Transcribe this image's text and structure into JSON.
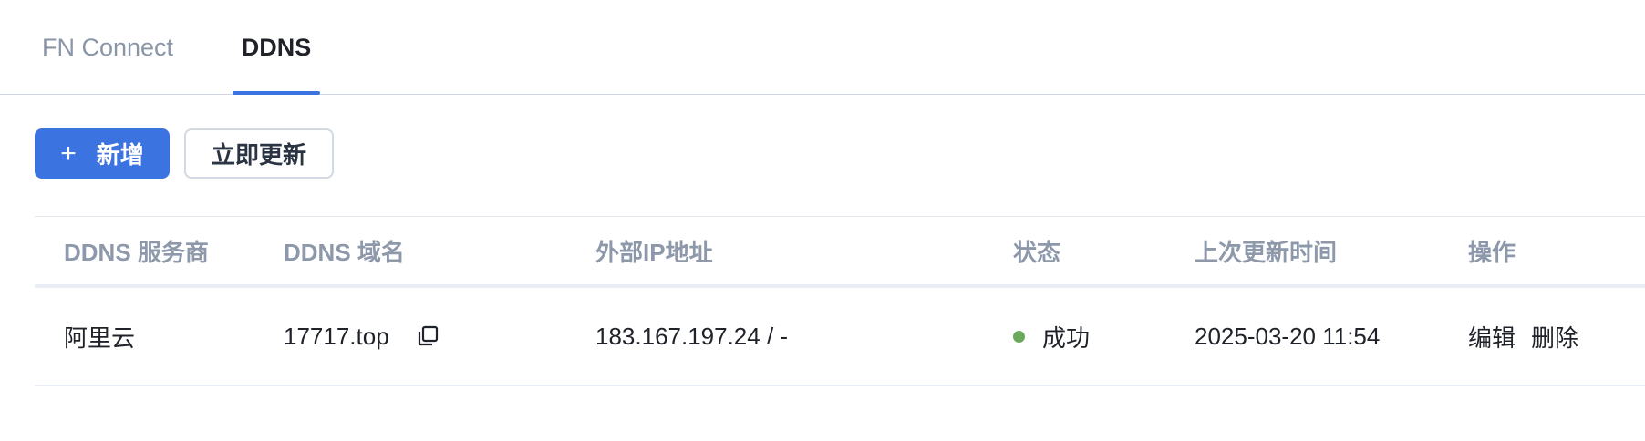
{
  "tabs": [
    {
      "label": "FN Connect",
      "active": false
    },
    {
      "label": "DDNS",
      "active": true
    }
  ],
  "toolbar": {
    "add_icon": "+",
    "add_label": "新增",
    "update_label": "立即更新"
  },
  "table": {
    "headers": [
      "DDNS 服务商",
      "DDNS 域名",
      "外部IP地址",
      "状态",
      "上次更新时间",
      "操作"
    ],
    "rows": [
      {
        "provider": "阿里云",
        "domain": "17717.top",
        "domain_icon": "copy-icon",
        "ip": "183.167.197.24 / -",
        "status": "成功",
        "status_color": "#6aa85c",
        "last_update": "2025-03-20 11:54",
        "actions": [
          "编辑",
          "删除"
        ]
      }
    ]
  },
  "colors": {
    "accent": "#3b73e0",
    "success": "#6aa85c"
  }
}
